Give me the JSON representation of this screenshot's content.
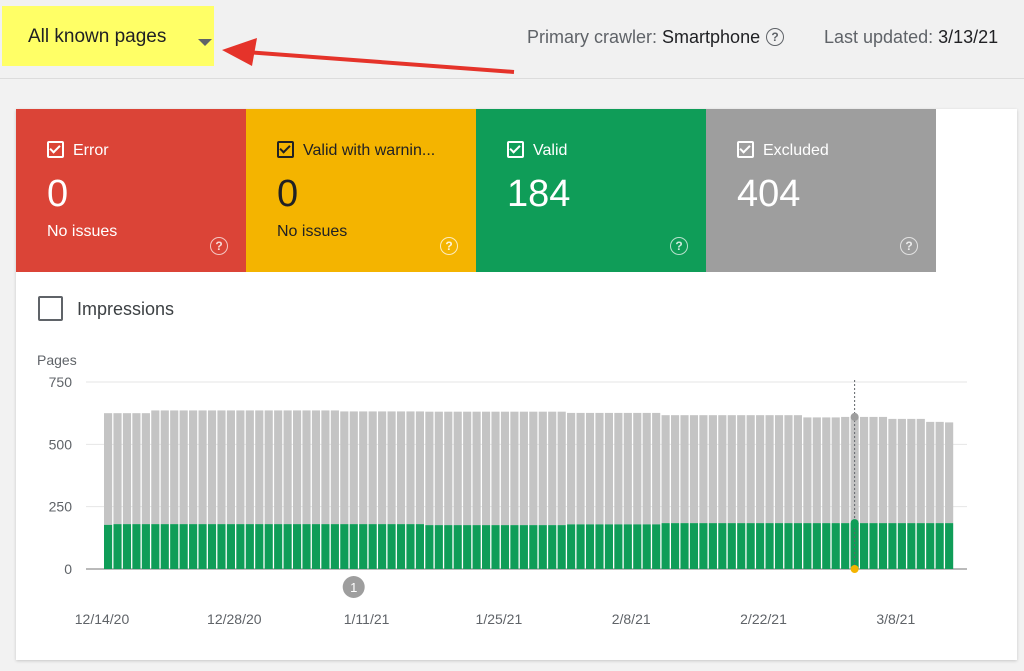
{
  "header": {
    "selector_label": "All known pages",
    "crawler_label": "Primary crawler:",
    "crawler_value": "Smartphone",
    "updated_label": "Last updated:",
    "updated_value": "3/13/21",
    "help_glyph": "?"
  },
  "tiles": [
    {
      "name": "Error",
      "count": "0",
      "sub": "No issues",
      "color": "#db4437"
    },
    {
      "name": "Valid with warnin...",
      "count": "0",
      "sub": "No issues",
      "color": "#f4b400"
    },
    {
      "name": "Valid",
      "count": "184",
      "sub": "",
      "color": "#0f9d58"
    },
    {
      "name": "Excluded",
      "count": "404",
      "sub": "",
      "color": "#9e9e9e"
    }
  ],
  "impressions_label": "Impressions",
  "annotation_marker": "1",
  "chart_data": {
    "type": "bar",
    "stacked": true,
    "ylabel": "Pages",
    "ylim": [
      0,
      750
    ],
    "yticks": [
      "750",
      "500",
      "250",
      "0"
    ],
    "xticks": [
      "12/14/20",
      "12/28/20",
      "1/11/21",
      "1/25/21",
      "2/8/21",
      "2/22/21",
      "3/8/21"
    ],
    "grid": true,
    "colors": {
      "valid": "#0f9d58",
      "excluded": "#c4c4c4",
      "marker": "#f4b400"
    },
    "x_start": "2020-12-14",
    "x_end": "2021-03-13",
    "series": [
      {
        "name": "Valid",
        "values": [
          177,
          180,
          180,
          180,
          180,
          180,
          180,
          180,
          180,
          180,
          180,
          180,
          180,
          180,
          180,
          180,
          180,
          180,
          180,
          180,
          180,
          180,
          180,
          180,
          180,
          180,
          180,
          180,
          180,
          180,
          180,
          180,
          180,
          180,
          176,
          176,
          176,
          176,
          176,
          176,
          176,
          176,
          176,
          176,
          176,
          176,
          176,
          176,
          176,
          179,
          179,
          179,
          179,
          179,
          179,
          179,
          179,
          179,
          179,
          184,
          184,
          184,
          184,
          184,
          184,
          184,
          184,
          184,
          184,
          184,
          184,
          184,
          184,
          184,
          184,
          184,
          184,
          184,
          184,
          184,
          184,
          184,
          184,
          184,
          184,
          184,
          184,
          184,
          184,
          184
        ]
      },
      {
        "name": "Excluded",
        "values": [
          448,
          445,
          445,
          445,
          445,
          456,
          456,
          456,
          456,
          456,
          456,
          456,
          456,
          456,
          456,
          456,
          456,
          456,
          456,
          456,
          456,
          456,
          456,
          456,
          456,
          452,
          452,
          452,
          452,
          452,
          452,
          452,
          452,
          452,
          455,
          455,
          455,
          455,
          455,
          455,
          455,
          455,
          455,
          455,
          455,
          455,
          455,
          455,
          455,
          447,
          447,
          447,
          447,
          447,
          447,
          447,
          447,
          447,
          447,
          433,
          433,
          433,
          433,
          433,
          433,
          433,
          433,
          433,
          433,
          433,
          433,
          433,
          433,
          433,
          424,
          424,
          424,
          424,
          426,
          426,
          426,
          426,
          426,
          418,
          418,
          418,
          418,
          406,
          406,
          404
        ]
      }
    ]
  }
}
